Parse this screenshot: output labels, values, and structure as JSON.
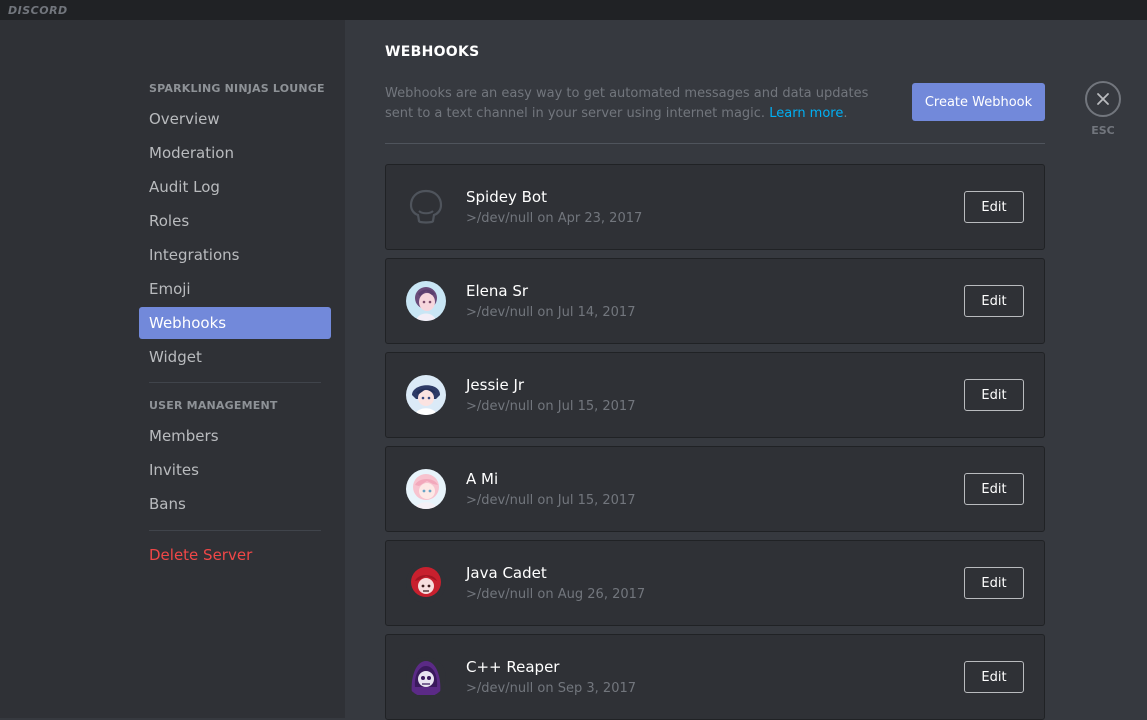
{
  "app": {
    "logo": "DISCORD"
  },
  "sidebar": {
    "server_section": "SPARKLING NINJAS LOUNGE",
    "items": [
      "Overview",
      "Moderation",
      "Audit Log",
      "Roles",
      "Integrations",
      "Emoji",
      "Webhooks",
      "Widget"
    ],
    "active": "Webhooks",
    "user_section": "USER MANAGEMENT",
    "user_items": [
      "Members",
      "Invites",
      "Bans"
    ],
    "delete_label": "Delete Server"
  },
  "main": {
    "title": "WEBHOOKS",
    "description": "Webhooks are an easy way to get automated messages and data updates sent to a text channel in your server using internet magic.",
    "learn_more": "Learn more",
    "create_button": "Create Webhook",
    "esc_label": "ESC",
    "webhooks": [
      {
        "name": "Spidey Bot",
        "meta": ">/dev/null on Apr 23, 2017",
        "avatar": "default-bot-icon",
        "edit_label": "Edit"
      },
      {
        "name": "Elena Sr",
        "meta": ">/dev/null on Jul 14, 2017",
        "avatar": "anime-girl-pink-avatar",
        "edit_label": "Edit"
      },
      {
        "name": "Jessie Jr",
        "meta": ">/dev/null on Jul 15, 2017",
        "avatar": "anime-girl-blue-avatar",
        "edit_label": "Edit"
      },
      {
        "name": "A Mi",
        "meta": ">/dev/null on Jul 15, 2017",
        "avatar": "anime-girl-light-avatar",
        "edit_label": "Edit"
      },
      {
        "name": "Java Cadet",
        "meta": ">/dev/null on Aug 26, 2017",
        "avatar": "red-hair-avatar",
        "edit_label": "Edit"
      },
      {
        "name": "C++ Reaper",
        "meta": ">/dev/null on Sep 3, 2017",
        "avatar": "purple-reaper-avatar",
        "edit_label": "Edit"
      }
    ]
  },
  "colors": {
    "accent": "#7289da",
    "danger": "#f04747",
    "link": "#00b0f4"
  }
}
